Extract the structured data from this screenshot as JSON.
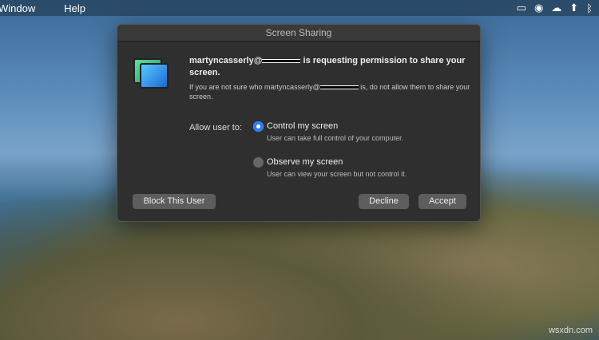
{
  "menubar": {
    "items": [
      "Window",
      "Help"
    ],
    "tray_icons": [
      "display-icon",
      "sync-icon",
      "cloud-icon",
      "cloud-upload-icon",
      "bluetooth-icon"
    ]
  },
  "dialog": {
    "title": "Screen Sharing",
    "heading_user": "martyncasserly@",
    "heading_rest": "is requesting permission to share your screen.",
    "sub_user": "If you are not sure who martyncasserly@",
    "sub_rest": "is, do not allow them to share your screen.",
    "allow_label": "Allow user to:",
    "options": [
      {
        "label": "Control my screen",
        "desc": "User can take full control of your computer.",
        "selected": true
      },
      {
        "label": "Observe my screen",
        "desc": "User can view your screen but not control it.",
        "selected": false
      }
    ],
    "buttons": {
      "block": "Block This User",
      "decline": "Decline",
      "accept": "Accept"
    }
  },
  "watermark": "wsxdn.com",
  "accent": "#2f7bf5"
}
